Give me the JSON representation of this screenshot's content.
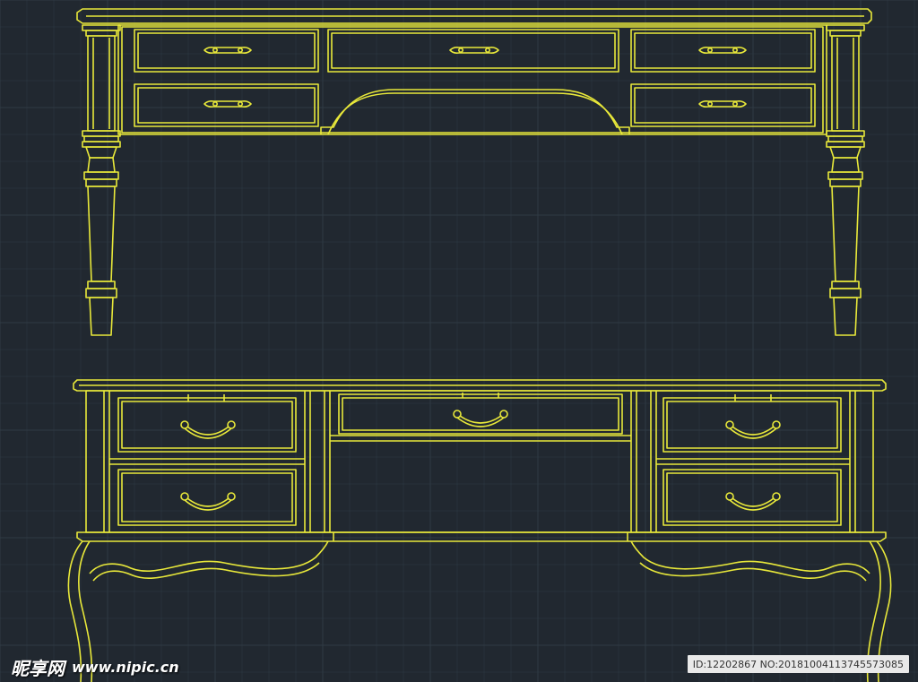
{
  "viewport": {
    "background": "#212830",
    "grid_color": "#2f3a44",
    "line_color": "#e8e83a"
  },
  "drawing": {
    "elevation_top": {
      "drawer_count": 5,
      "handle_icon": "bar-handle-icon"
    },
    "elevation_bottom": {
      "drawer_count": 5,
      "handle_icon": "bow-handle-icon"
    }
  },
  "watermark": {
    "site_name": "昵享网",
    "site_url": "www.nipic.cn",
    "image_info": "ID:12202867 NO:20181004113745573085"
  }
}
